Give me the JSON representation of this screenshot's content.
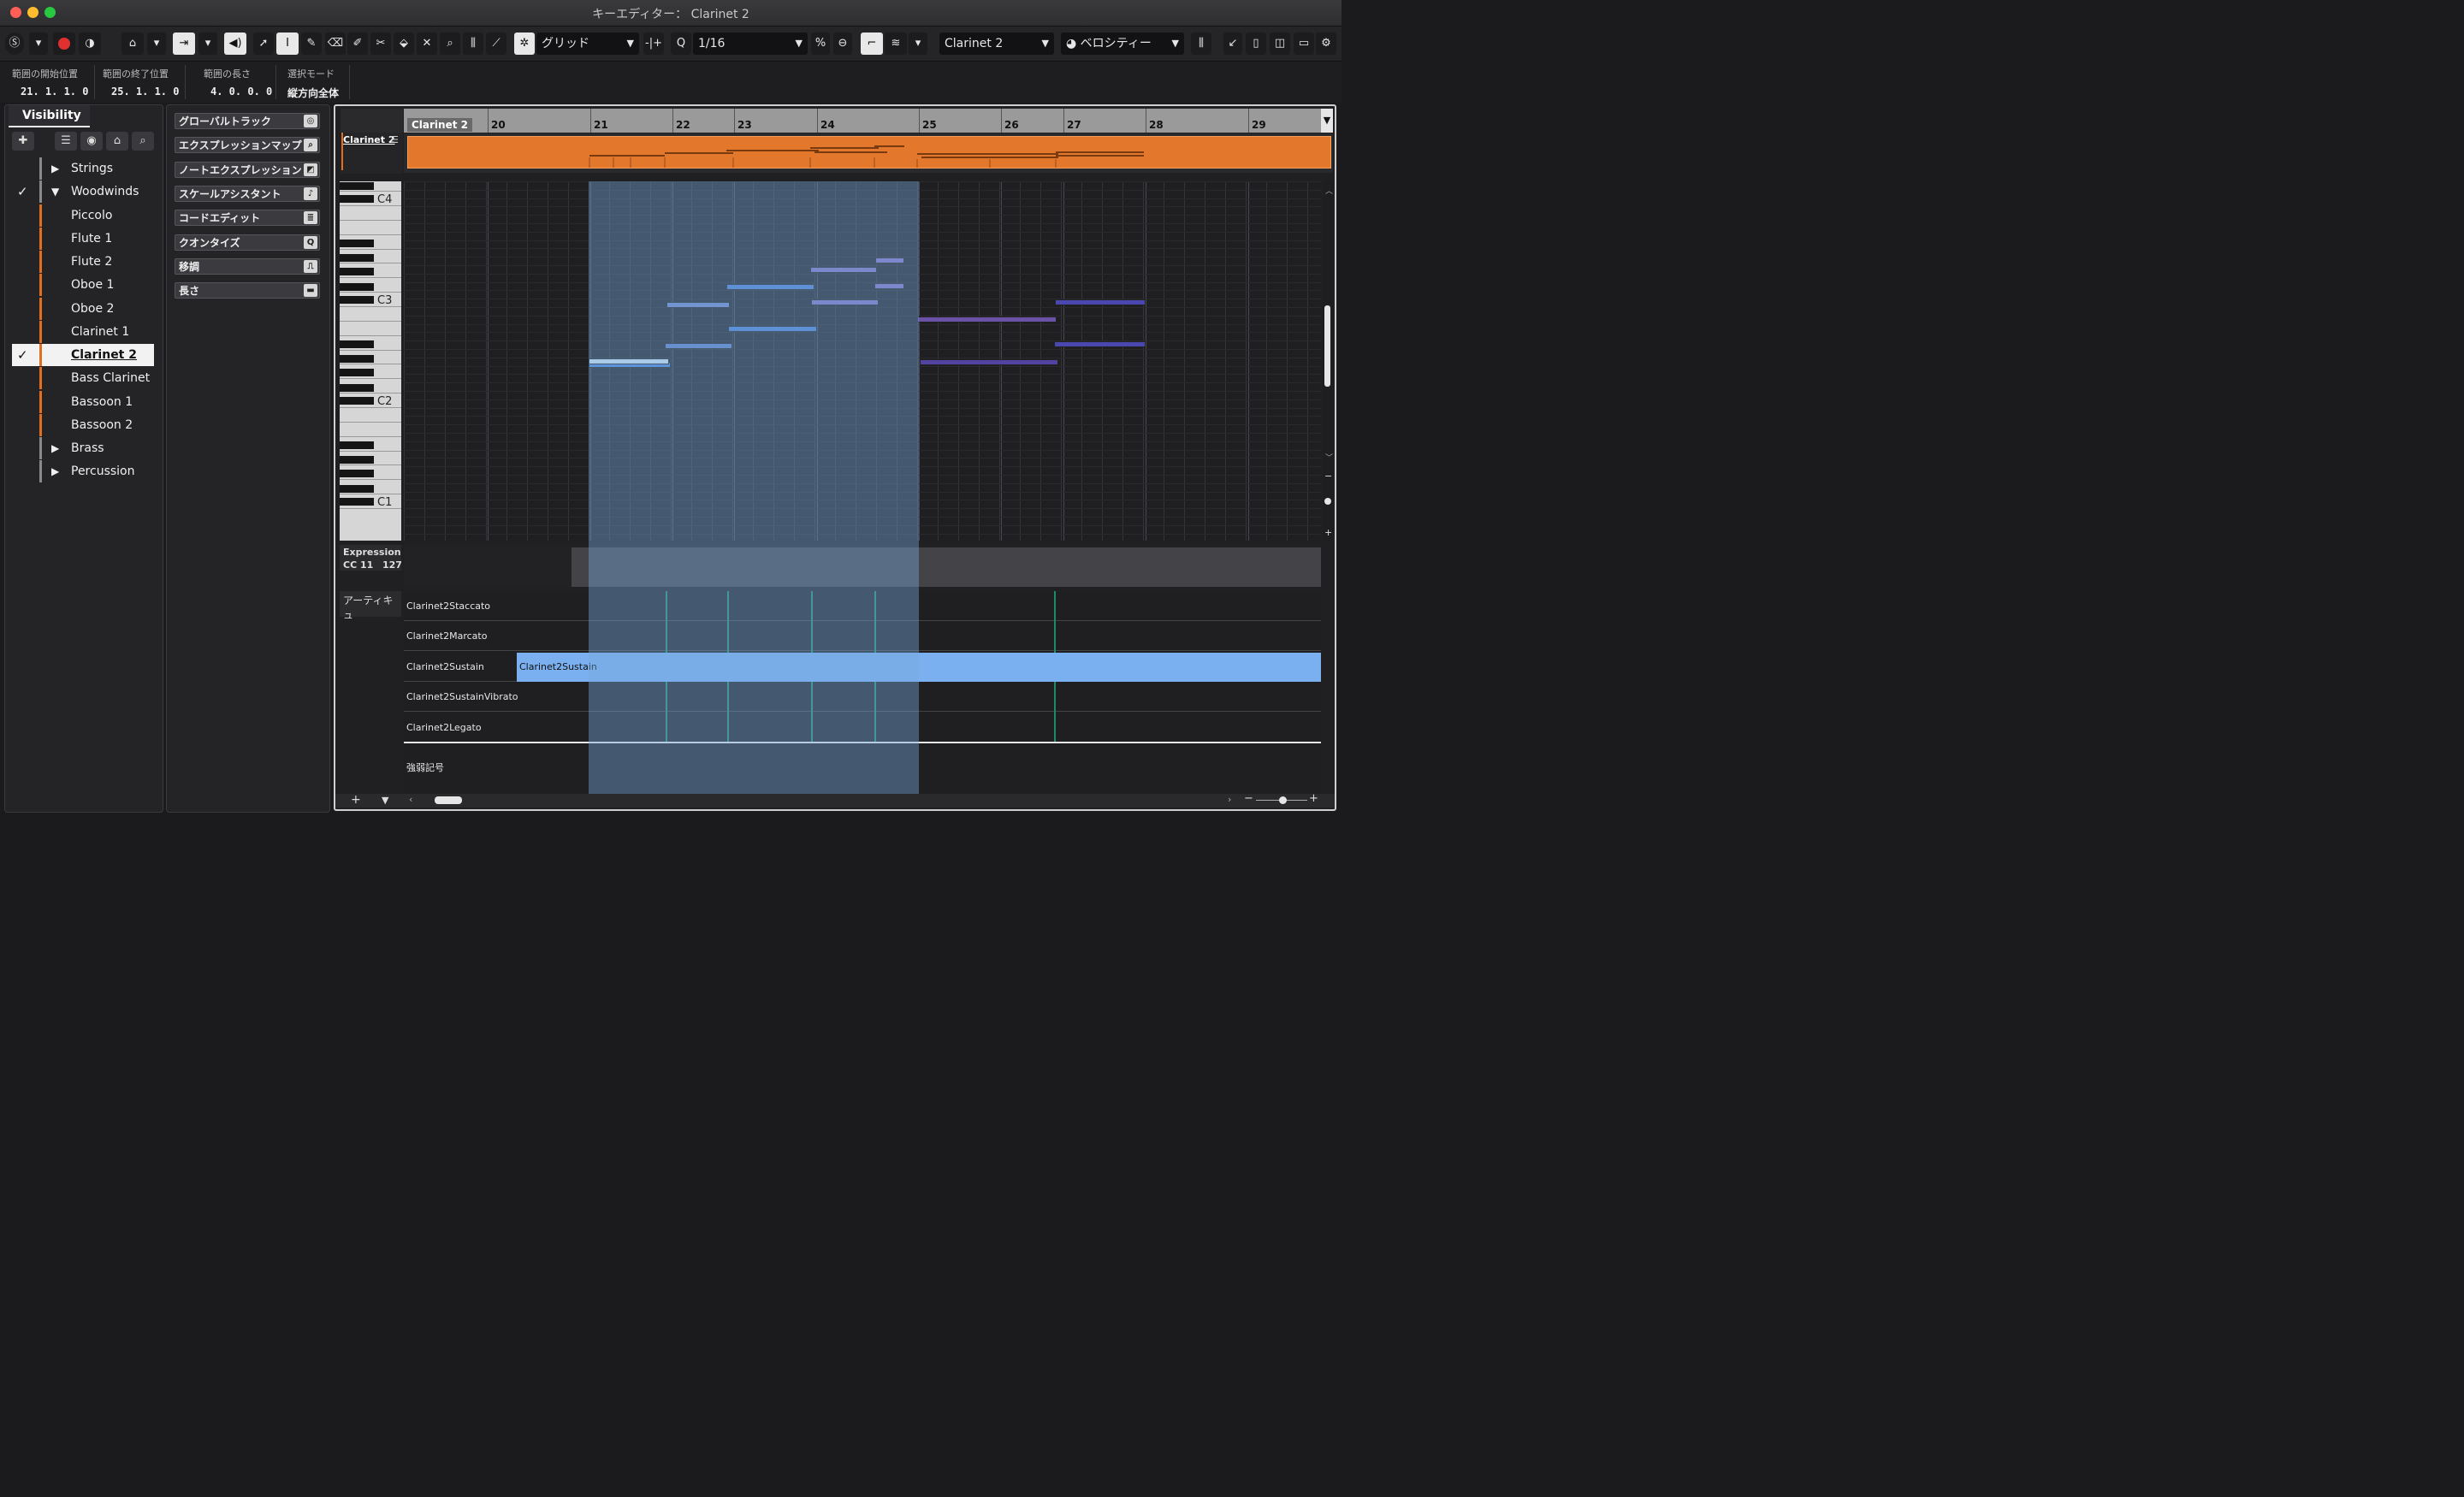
{
  "window": {
    "title": "キーエディター： Clarinet 2"
  },
  "toolbar": {
    "snap_type": "グリッド",
    "quantize": "1/16",
    "track_select": "Clarinet 2",
    "event_color": "ベロシティー"
  },
  "info": [
    {
      "label": "範囲の開始位置",
      "value": "21. 1. 1.   0"
    },
    {
      "label": "範囲の終了位置",
      "value": "25. 1. 1.   0"
    },
    {
      "label": "範囲の長さ",
      "value": "4. 0. 0.   0"
    },
    {
      "label": "選択モード",
      "value": "縦方向全体"
    }
  ],
  "visibility": {
    "tab": "Visibility",
    "items": [
      {
        "label": "Strings",
        "type": "folder",
        "checked": false,
        "expanded": false
      },
      {
        "label": "Woodwinds",
        "type": "folder",
        "checked": true,
        "expanded": true
      },
      {
        "label": "Piccolo",
        "type": "track",
        "checked": false
      },
      {
        "label": "Flute 1",
        "type": "track",
        "checked": false
      },
      {
        "label": "Flute 2",
        "type": "track",
        "checked": false
      },
      {
        "label": "Oboe 1",
        "type": "track",
        "checked": false
      },
      {
        "label": "Oboe 2",
        "type": "track",
        "checked": false
      },
      {
        "label": "Clarinet 1",
        "type": "track",
        "checked": false
      },
      {
        "label": "Clarinet 2",
        "type": "track",
        "checked": true,
        "selected": true
      },
      {
        "label": "Bass Clarinet",
        "type": "track",
        "checked": false
      },
      {
        "label": "Bassoon 1",
        "type": "track",
        "checked": false
      },
      {
        "label": "Bassoon 2",
        "type": "track",
        "checked": false
      },
      {
        "label": "Brass",
        "type": "folder",
        "checked": false,
        "expanded": false
      },
      {
        "label": "Percussion",
        "type": "folder",
        "checked": false,
        "expanded": false
      }
    ]
  },
  "inspector": {
    "sections": [
      {
        "label": "グローバルトラック",
        "icon": "◎"
      },
      {
        "label": "エクスプレッションマップ",
        "icon": "⌕"
      },
      {
        "label": "ノートエクスプレッション",
        "icon": "◩"
      },
      {
        "label": "スケールアシスタント",
        "icon": "♪"
      },
      {
        "label": "コードエディット",
        "icon": "≣"
      },
      {
        "label": "クオンタイズ",
        "icon": "Q"
      },
      {
        "label": "移調",
        "icon": "⎍"
      },
      {
        "label": "長さ",
        "icon": "▬"
      }
    ]
  },
  "editor": {
    "track_name": "Clarinet 2",
    "ruler_label": "Clarinet 2",
    "bars": [
      "20",
      "21",
      "22",
      "23",
      "24",
      "25",
      "26",
      "27",
      "28",
      "29"
    ],
    "key_labels": [
      "C4",
      "C3",
      "C2",
      "C1"
    ],
    "controller": {
      "name": "Expression",
      "cc": "CC 11",
      "value": "127"
    },
    "articulation_header": "アーティキュ",
    "articulations": [
      "Clarinet2Staccato",
      "Clarinet2Marcato",
      "Clarinet2Sustain",
      "Clarinet2SustainVibrato",
      "Clarinet2Legato"
    ],
    "sustain_event": "Clarinet2Sustain",
    "dynamics_label": "強弱記号"
  },
  "colors": {
    "part": "#e3772c",
    "selection": "#6f9cc6",
    "note_blue": "#5a8ee0",
    "note_purple": "#6a5ab0",
    "articulation_event": "#7ab0f0"
  }
}
